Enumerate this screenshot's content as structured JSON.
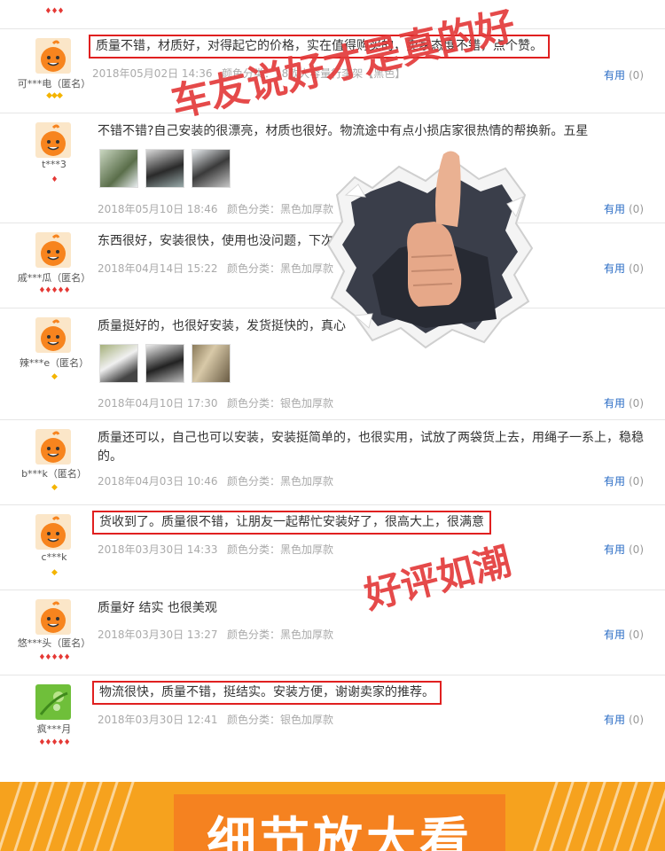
{
  "colors": {
    "accent_red": "#e02020",
    "link_blue": "#2a6cc5",
    "footer_orange": "#f6a21e",
    "footer_box": "#f58220"
  },
  "top_rank": "♦♦♦",
  "reviews": [
    {
      "user": "可***电（匿名）",
      "rank": "◆◆◆",
      "content": "质量不错，材质好，对得起它的价格，实在值得购买的，卖家态度不错，点个赞。",
      "time": "2018年05月02日 14:36",
      "variant": "颜色分类：18款大容量行李架【黑色】",
      "useful_label": "有用",
      "useful_count": "(0)"
    },
    {
      "user": "t***3",
      "rank": "♦",
      "content": "不错不错?自己安装的很漂亮，材质也很好。物流途中有点小损店家很热情的帮换新。五星",
      "time": "2018年05月10日 18:46",
      "variant": "颜色分类：黑色加厚款",
      "useful_label": "有用",
      "useful_count": "(0)"
    },
    {
      "user": "戚***瓜（匿名）",
      "rank": "♦♦♦♦♦",
      "content": "东西很好，安装很快，使用也没问题，下次",
      "time": "2018年04月14日 15:22",
      "variant": "颜色分类：黑色加厚款",
      "useful_label": "有用",
      "useful_count": "(0)"
    },
    {
      "user": "辣***e（匿名）",
      "rank": "◆",
      "content": "质量挺好的，也很好安装，发货挺快的，真心",
      "time": "2018年04月10日 17:30",
      "variant": "颜色分类：银色加厚款",
      "useful_label": "有用",
      "useful_count": "(0)"
    },
    {
      "user": "b***k（匿名）",
      "rank": "◆",
      "content": "质量还可以，自己也可以安装，安装挺简单的，也很实用，试放了两袋货上去，用绳子一系上，稳稳的。",
      "time": "2018年04月03日 10:46",
      "variant": "颜色分类：黑色加厚款",
      "useful_label": "有用",
      "useful_count": "(0)"
    },
    {
      "user": "c***k",
      "rank": "◆",
      "content": "货收到了。质量很不错，让朋友一起帮忙安装好了，很高大上，很满意",
      "time": "2018年03月30日 14:33",
      "variant": "颜色分类：黑色加厚款",
      "useful_label": "有用",
      "useful_count": "(0)"
    },
    {
      "user": "悠***头（匿名）",
      "rank": "♦♦♦♦♦",
      "content": "质量好 结实 也很美观",
      "time": "2018年03月30日 13:27",
      "variant": "颜色分类：黑色加厚款",
      "useful_label": "有用",
      "useful_count": "(0)"
    },
    {
      "user": "疯***月",
      "rank": "♦♦♦♦♦",
      "content": "物流很快，质量不错，挺结实。安装方便，谢谢卖家的推荐。",
      "time": "2018年03月30日 12:41",
      "variant": "颜色分类：银色加厚款",
      "useful_label": "有用",
      "useful_count": "(0)"
    }
  ],
  "overlay_1": "车友说好才是真的好",
  "overlay_2": "好评如潮",
  "footer_title": "细节放大看"
}
